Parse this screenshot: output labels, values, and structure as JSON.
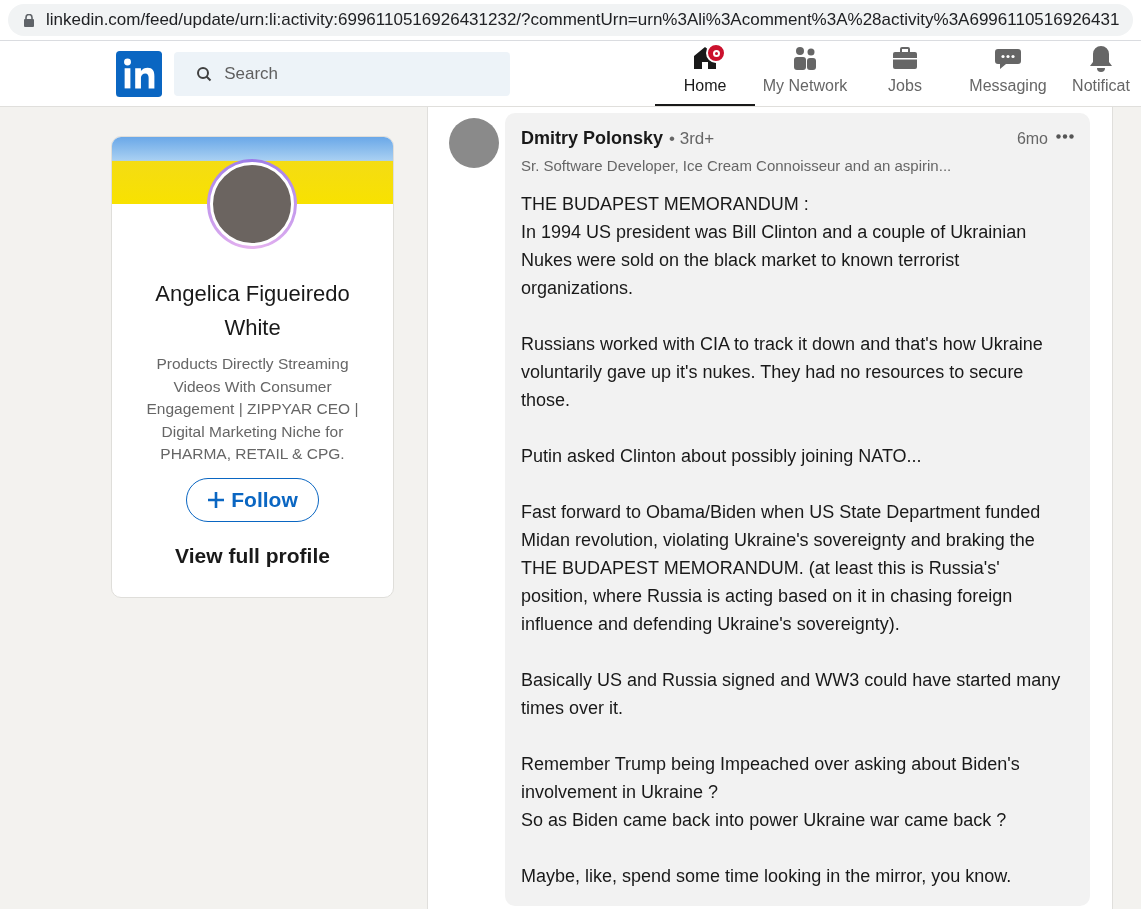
{
  "address_bar": {
    "url": "linkedin.com/feed/update/urn:li:activity:6996110516926431232/?commentUrn=urn%3Ali%3Acomment%3A%28activity%3A6996110516926431"
  },
  "search": {
    "placeholder": "Search"
  },
  "nav": [
    {
      "kind": "home",
      "label": "Home",
      "selected": true,
      "badge": true
    },
    {
      "kind": "network",
      "label": "My Network",
      "selected": false,
      "badge": false
    },
    {
      "kind": "jobs",
      "label": "Jobs",
      "selected": false,
      "badge": false
    },
    {
      "kind": "messaging",
      "label": "Messaging",
      "selected": false,
      "badge": false
    },
    {
      "kind": "notifications",
      "label": "Notificat",
      "selected": false,
      "badge": false
    }
  ],
  "profile_card": {
    "name": "Angelica Figueiredo White",
    "headline": "Products Directly Streaming Videos With Consumer Engagement | ZIPPYAR CEO | Digital Marketing Niche for PHARMA, RETAIL & CPG.",
    "follow_button": "Follow",
    "view_profile": "View full profile"
  },
  "comment": {
    "author": "Dmitry Polonsky",
    "degree": "• 3rd+",
    "headline": "Sr. Software Developer, Ice Cream Connoisseur and an aspirin...",
    "time": "6mo",
    "paragraphs": [
      [
        "THE BUDAPEST MEMORANDUM :",
        "In 1994 US president was Bill Clinton and a couple of Ukrainian Nukes were sold on the black market to known terrorist organizations."
      ],
      [
        "Russians worked with CIA to track it down and that's how Ukraine voluntarily gave up it's nukes. They had no resources to secure those."
      ],
      [
        "Putin asked Clinton about possibly joining NATO..."
      ],
      [
        "Fast forward to Obama/Biden when US State Department funded Midan revolution, violating Ukraine's sovereignty and braking the THE BUDAPEST MEMORANDUM. (at least this is Russia's' position, where Russia is acting based on it in chasing foreign influence and defending Ukraine's sovereignty)."
      ],
      [
        "Basically US and Russia signed and WW3 could have started many times over it."
      ],
      [
        "Remember Trump being Impeached over asking about Biden's involvement in Ukraine ?",
        "So as Biden came back into power Ukraine war came back ?"
      ],
      [
        "Maybe, like, spend some time looking in the mirror, you know."
      ]
    ]
  }
}
